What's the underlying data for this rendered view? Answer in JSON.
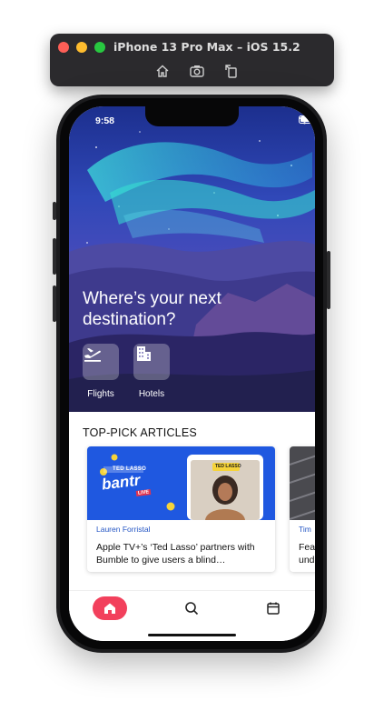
{
  "simulator": {
    "title": "iPhone 13 Pro Max – iOS 15.2",
    "tools": [
      "home-icon",
      "screenshot-icon",
      "rotate-icon"
    ]
  },
  "status_bar": {
    "time": "9:58"
  },
  "hero": {
    "headline": "Where’s your next destination?",
    "quick_actions": [
      {
        "label": "Flights",
        "icon": "airplane-departure-icon"
      },
      {
        "label": "Hotels",
        "icon": "hotel-building-icon"
      }
    ]
  },
  "articles": {
    "section_title": "TOP-PICK ARTICLES",
    "items": [
      {
        "author": "Lauren Forristal",
        "title": "Apple TV+’s ‘Ted Lasso’ partners with Bumble to give users a blind…",
        "image_text": {
          "badge": "TED LASSO",
          "brand": "bantr",
          "tag": "LIVE",
          "tile": "TED LASSO"
        }
      },
      {
        "author": "Tim",
        "title": "Fea… und…"
      }
    ]
  },
  "tab_bar": {
    "active": "home",
    "tabs": [
      {
        "id": "home",
        "icon": "home-icon"
      },
      {
        "id": "search",
        "icon": "search-icon"
      },
      {
        "id": "calendar",
        "icon": "calendar-icon"
      }
    ]
  },
  "colors": {
    "accent": "#f2405c",
    "link": "#2556c4",
    "card_blue": "#1f58e0"
  }
}
